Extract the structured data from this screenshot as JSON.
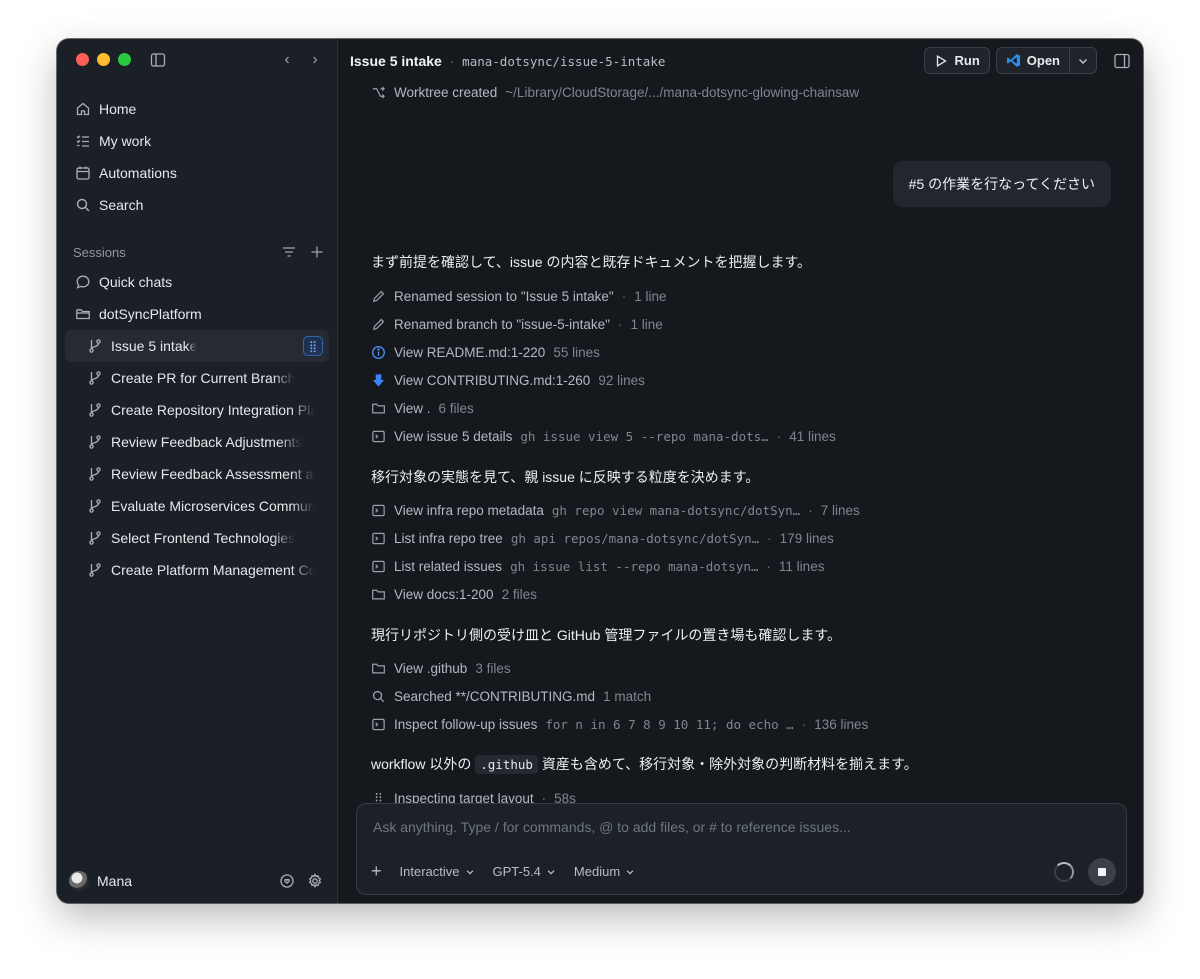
{
  "window": {
    "buttons": [
      "close",
      "minimize",
      "zoom"
    ]
  },
  "sidebar": {
    "nav": [
      {
        "label": "Home",
        "icon": "home-icon"
      },
      {
        "label": "My work",
        "icon": "checklist-icon"
      },
      {
        "label": "Automations",
        "icon": "calendar-icon"
      },
      {
        "label": "Search",
        "icon": "search-icon"
      }
    ],
    "sessions_label": "Sessions",
    "quick_chats": "Quick chats",
    "project": "dotSyncPlatform",
    "sessions": [
      "Issue 5 intake",
      "Create PR for Current Branch",
      "Create Repository Integration Plan",
      "Review Feedback Adjustments",
      "Review Feedback Assessment and",
      "Evaluate Microservices Communication",
      "Select Frontend Technologies",
      "Create Platform Management Console"
    ],
    "active_session_index": 0,
    "user": "Mana"
  },
  "header": {
    "title": "Issue 5 intake",
    "separator": "·",
    "branch": "mana-dotsync/issue-5-intake",
    "run_label": "Run",
    "open_label": "Open"
  },
  "conversation": {
    "worktree": {
      "label": "Worktree created",
      "path": "~/Library/CloudStorage/.../mana-dotsync-glowing-chainsaw"
    },
    "user_message": "#5 の作業を行なってください",
    "prose1": "まず前提を確認して、issue の内容と既存ドキュメントを把握します。",
    "group1": [
      {
        "icon": "pencil-icon",
        "label": "Renamed session to \"Issue 5 intake\"",
        "cmd": "",
        "meta": "1 line",
        "dot": true
      },
      {
        "icon": "pencil-icon",
        "label": "Renamed branch to \"issue-5-intake\"",
        "cmd": "",
        "meta": "1 line",
        "dot": true
      },
      {
        "icon": "info-icon",
        "label": "View README.md:1-220",
        "cmd": "",
        "meta": "55 lines",
        "dot": false
      },
      {
        "icon": "download-icon",
        "label": "View CONTRIBUTING.md:1-260",
        "cmd": "",
        "meta": "92 lines",
        "dot": false
      },
      {
        "icon": "folder-icon",
        "label": "View .",
        "cmd": "",
        "meta": "6 files",
        "dot": false
      },
      {
        "icon": "terminal-icon",
        "label": "View issue 5 details",
        "cmd": "gh issue view 5 --repo mana-dots…",
        "meta": "41 lines",
        "dot": true
      }
    ],
    "prose2": "移行対象の実態を見て、親 issue に反映する粒度を決めます。",
    "group2": [
      {
        "icon": "terminal-icon",
        "label": "View infra repo metadata",
        "cmd": "gh repo view mana-dotsync/dotSyn…",
        "meta": "7 lines",
        "dot": true
      },
      {
        "icon": "terminal-icon",
        "label": "List infra repo tree",
        "cmd": "gh api repos/mana-dotsync/dotSyn…",
        "meta": "179 lines",
        "dot": true
      },
      {
        "icon": "terminal-icon",
        "label": "List related issues",
        "cmd": "gh issue list --repo mana-dotsyn…",
        "meta": "11 lines",
        "dot": true
      },
      {
        "icon": "folder-icon",
        "label": "View docs:1-200",
        "cmd": "",
        "meta": "2 files",
        "dot": false
      }
    ],
    "prose3": "現行リポジトリ側の受け皿と GitHub 管理ファイルの置き場も確認します。",
    "group3": [
      {
        "icon": "folder-icon",
        "label": "View .github",
        "cmd": "",
        "meta": "3 files",
        "dot": false
      },
      {
        "icon": "search-icon",
        "label": "Searched **/CONTRIBUTING.md",
        "cmd": "",
        "meta": "1 match",
        "dot": false
      },
      {
        "icon": "terminal-icon",
        "label": "Inspect follow-up issues",
        "cmd": "for n in 6 7 8 9 10 11; do echo …",
        "meta": "136 lines",
        "dot": true
      }
    ],
    "prose4_pre": "workflow 以外の",
    "prose4_code": ".github",
    "prose4_post": "資産も含めて、移行対象・除外対象の判断材料を揃えます。",
    "status": {
      "label": "Inspecting target layout",
      "elapsed": "58s"
    }
  },
  "composer": {
    "placeholder": "Ask anything. Type / for commands, @ to add files, or # to reference issues...",
    "mode": "Interactive",
    "model": "GPT-5.4",
    "effort": "Medium"
  },
  "colors": {
    "window_bg": "#15181d",
    "sidebar_bg": "#1b1f26",
    "accent_blue": "#3b82f6"
  }
}
